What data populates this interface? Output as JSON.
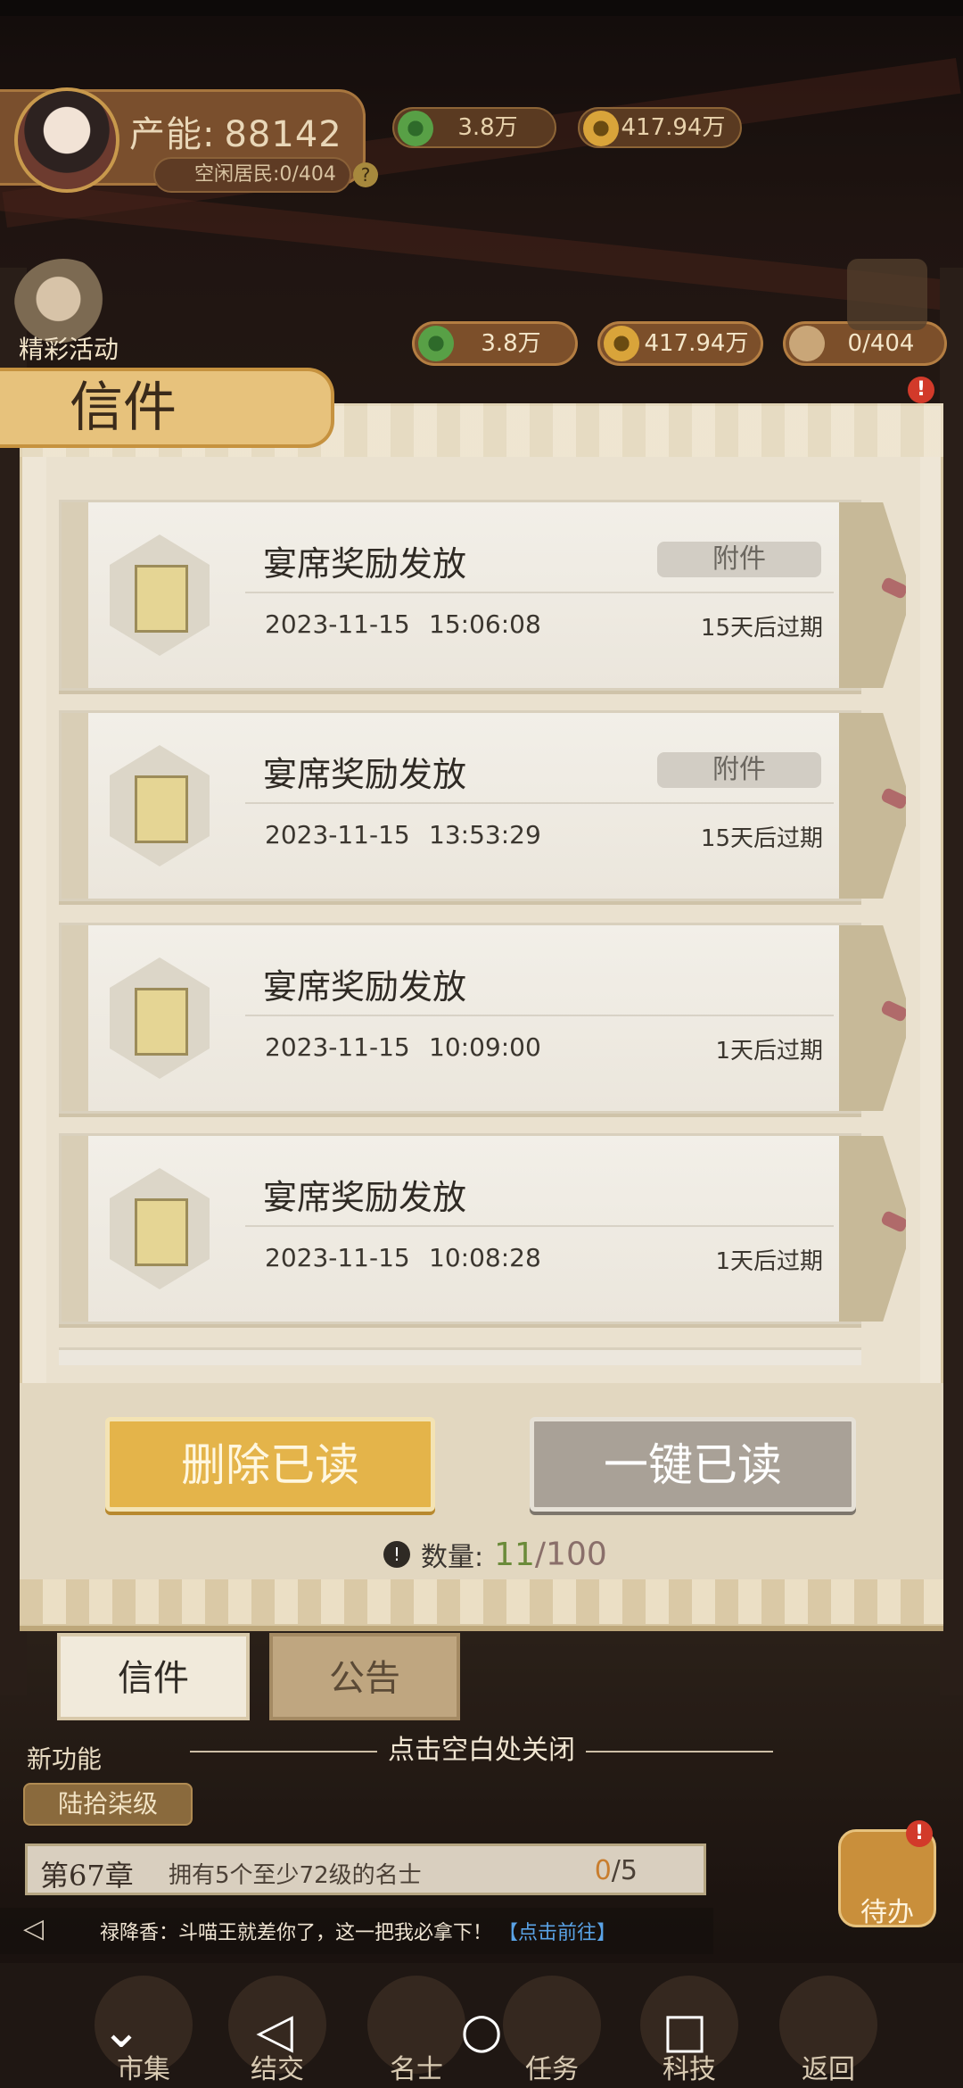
{
  "hud": {
    "production_label": "产能:",
    "production_value": "88142",
    "idle_residents": "空闲居民:0/404",
    "help": "?",
    "top_resources": [
      {
        "icon": "green-coin-icon",
        "value": "3.8万"
      },
      {
        "icon": "gold-coin-icon",
        "value": "417.94万"
      }
    ],
    "resources": [
      {
        "icon": "green-coin-icon",
        "value": "3.8万"
      },
      {
        "icon": "gold-coin-icon",
        "value": "417.94万"
      },
      {
        "icon": "resident-icon",
        "value": "0/404"
      }
    ],
    "event_label": "精彩活动",
    "badge": "!"
  },
  "panel": {
    "title": "信件",
    "mails": [
      {
        "title": "宴席奖励发放",
        "date": "2023-11-15",
        "time": "15:06:08",
        "expire": "15天后过期",
        "attachment": "附件"
      },
      {
        "title": "宴席奖励发放",
        "date": "2023-11-15",
        "time": "13:53:29",
        "expire": "15天后过期",
        "attachment": "附件"
      },
      {
        "title": "宴席奖励发放",
        "date": "2023-11-15",
        "time": "10:09:00",
        "expire": "1天后过期",
        "attachment": null
      },
      {
        "title": "宴席奖励发放",
        "date": "2023-11-15",
        "time": "10:08:28",
        "expire": "1天后过期",
        "attachment": null
      }
    ],
    "delete_read_label": "删除已读",
    "mark_all_read_label": "一键已读",
    "count_label": "数量:",
    "count_current": "11",
    "count_max": "/100",
    "tabs": [
      {
        "label": "信件",
        "active": true
      },
      {
        "label": "公告",
        "active": false
      }
    ],
    "close_hint": "点击空白处关闭"
  },
  "game": {
    "new_feature": "新功能",
    "level": "陆拾柒级",
    "chapter": "第67章",
    "chapter_task": "拥有5个至少72级的名士",
    "chapter_progress_current": "0",
    "chapter_progress_total": "/5",
    "todo_label": "待办",
    "chat_text": "禄降香：斗喵王就差你了，这一把我必拿下！",
    "chat_link": "【点击前往】",
    "bottom_nav": [
      "市集",
      "结交",
      "名士",
      "任务",
      "科技",
      "返回"
    ]
  },
  "colors": {
    "panel_bg": "#eee6d6",
    "delete_button": "#e4b44a",
    "read_button": "#a9a197",
    "count_current": "#6b8b3a",
    "link": "#5aa3e6"
  }
}
